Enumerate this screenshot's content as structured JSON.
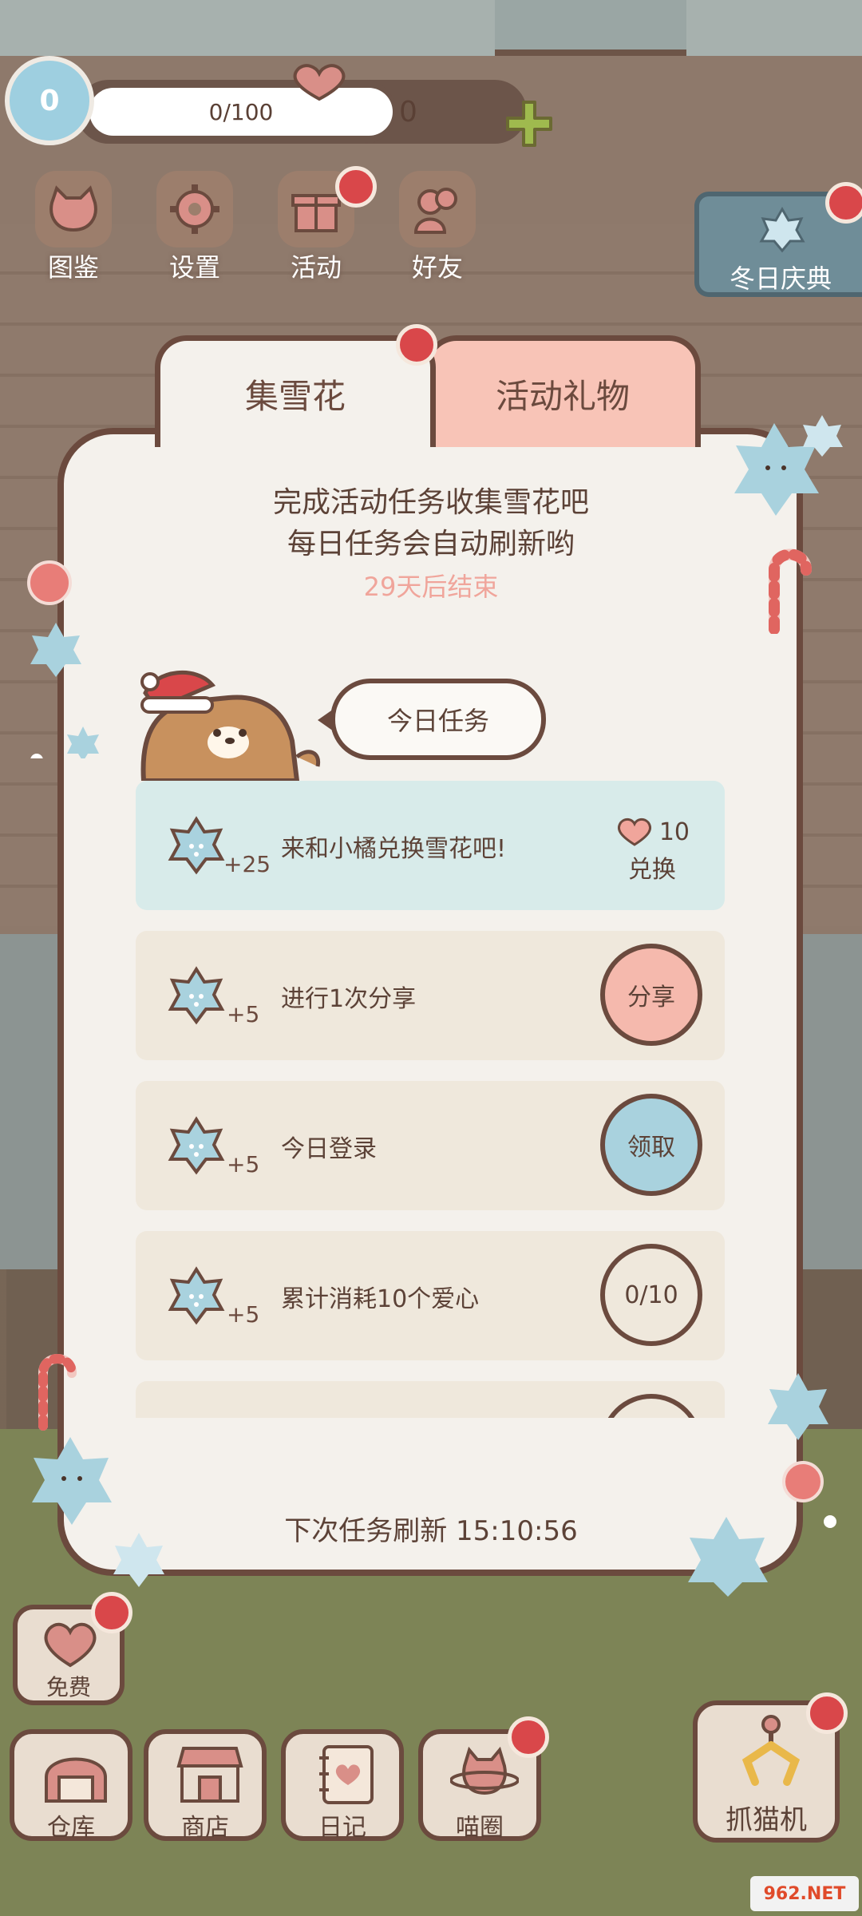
{
  "hud": {
    "level": "0",
    "xp_text": "0/100",
    "xp_progress": 0,
    "hearts": "0"
  },
  "menu": [
    {
      "label": "图鉴",
      "icon": "cat-face-icon"
    },
    {
      "label": "设置",
      "icon": "gear-icon"
    },
    {
      "label": "活动",
      "icon": "gift-icon"
    },
    {
      "label": "好友",
      "icon": "friends-icon"
    }
  ],
  "winter_event": {
    "label": "冬日庆典",
    "icon": "snowflake-icon"
  },
  "dialog": {
    "tabs": [
      {
        "label": "集雪花",
        "active": true
      },
      {
        "label": "活动礼物",
        "active": false
      }
    ],
    "intro_line1": "完成活动任务收集雪花吧",
    "intro_line2": "每日任务会自动刷新哟",
    "countdown": "29天后结束",
    "today_label": "今日任务",
    "tasks": [
      {
        "reward": "+25",
        "text": "来和小橘兑换雪花吧!",
        "cost": "10",
        "action": "兑换"
      },
      {
        "reward": "+5",
        "text": "进行1次分享",
        "action": "分享"
      },
      {
        "reward": "+5",
        "text": "今日登录",
        "action": "领取"
      },
      {
        "reward": "+5",
        "text": "累计消耗10个爱心",
        "action": "0/10"
      }
    ],
    "refresh_text": "下次任务刷新 15:10:56"
  },
  "bottom": {
    "free": "免费",
    "buttons": [
      {
        "label": "仓库",
        "icon": "warehouse-icon"
      },
      {
        "label": "商店",
        "icon": "shop-icon"
      },
      {
        "label": "日记",
        "icon": "diary-icon"
      },
      {
        "label": "喵圈",
        "icon": "cat-planet-icon"
      }
    ],
    "catch_machine": "抓猫机"
  },
  "watermark": "962.NET",
  "colors": {
    "panel": "#f4f1ec",
    "border": "#6b4a3e",
    "tab_inactive": "#f8c4b7",
    "snow_blue": "#a9d2de",
    "share_pink": "#f5b9ad",
    "countdown": "#f0a59b",
    "red_dot": "#d9474a"
  }
}
